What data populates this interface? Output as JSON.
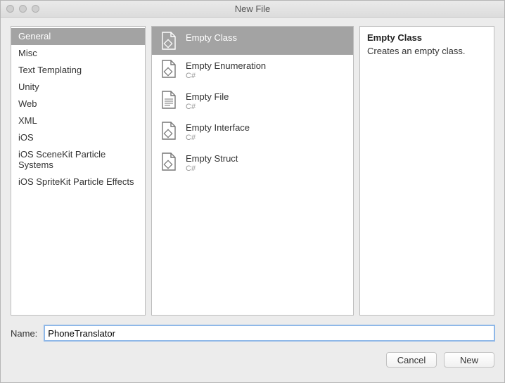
{
  "window": {
    "title": "New File"
  },
  "categories": [
    {
      "label": "General",
      "selected": true
    },
    {
      "label": "Misc"
    },
    {
      "label": "Text Templating"
    },
    {
      "label": "Unity"
    },
    {
      "label": "Web"
    },
    {
      "label": "XML"
    },
    {
      "label": "iOS"
    },
    {
      "label": "iOS SceneKit Particle Systems"
    },
    {
      "label": "iOS SpriteKit Particle Effects"
    }
  ],
  "templates": [
    {
      "label": "Empty Class",
      "sub": "",
      "icon": "class",
      "selected": true
    },
    {
      "label": "Empty Enumeration",
      "sub": "C#",
      "icon": "class"
    },
    {
      "label": "Empty File",
      "sub": "C#",
      "icon": "file"
    },
    {
      "label": "Empty Interface",
      "sub": "C#",
      "icon": "class"
    },
    {
      "label": "Empty Struct",
      "sub": "C#",
      "icon": "class"
    }
  ],
  "description": {
    "title": "Empty Class",
    "text": "Creates an empty class."
  },
  "form": {
    "name_label": "Name:",
    "name_value": "PhoneTranslator"
  },
  "buttons": {
    "cancel": "Cancel",
    "new": "New"
  }
}
